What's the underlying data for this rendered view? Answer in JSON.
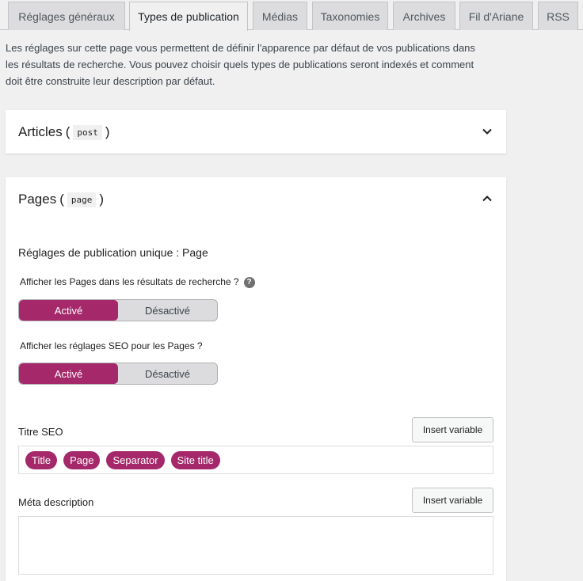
{
  "tabs": [
    {
      "label": "Réglages généraux",
      "active": false
    },
    {
      "label": "Types de publication",
      "active": true
    },
    {
      "label": "Médias",
      "active": false
    },
    {
      "label": "Taxonomies",
      "active": false
    },
    {
      "label": "Archives",
      "active": false
    },
    {
      "label": "Fil d'Ariane",
      "active": false
    },
    {
      "label": "RSS",
      "active": false
    }
  ],
  "intro": {
    "line1": "Les réglages sur cette page vous permettent de définir l'apparence par défaut de vos publications dans",
    "line2": "les résultats de recherche. Vous pouvez choisir quels types de publications seront indexés et comment",
    "line3": "doit être construite leur description par défaut."
  },
  "articles_panel": {
    "title": "Articles",
    "paren_open": "(",
    "code": "post",
    "paren_close": ")",
    "state": "collapsed",
    "icon": "chevron-down-icon"
  },
  "pages_panel": {
    "title": "Pages",
    "paren_open": "(",
    "code": "page",
    "paren_close": ")",
    "state": "expanded",
    "icon": "chevron-up-icon",
    "subheading": "Réglages de publication unique : Page",
    "q1_label": "Afficher les Pages dans les résultats de recherche ?",
    "q1_help": "?",
    "q1_on": "Activé",
    "q1_off": "Désactivé",
    "q2_label": "Afficher les réglages SEO pour les Pages ?",
    "q2_on": "Activé",
    "q2_off": "Désactivé",
    "seo_title_label": "Titre SEO",
    "insert_variable": "Insert variable",
    "seo_title_pills": [
      "Title",
      "Page",
      "Separator",
      "Site title"
    ],
    "meta_label": "Méta description",
    "meta_insert_variable": "Insert variable",
    "meta_value": ""
  },
  "colors": {
    "accent": "#a4286a",
    "background": "#f0f0f1"
  }
}
